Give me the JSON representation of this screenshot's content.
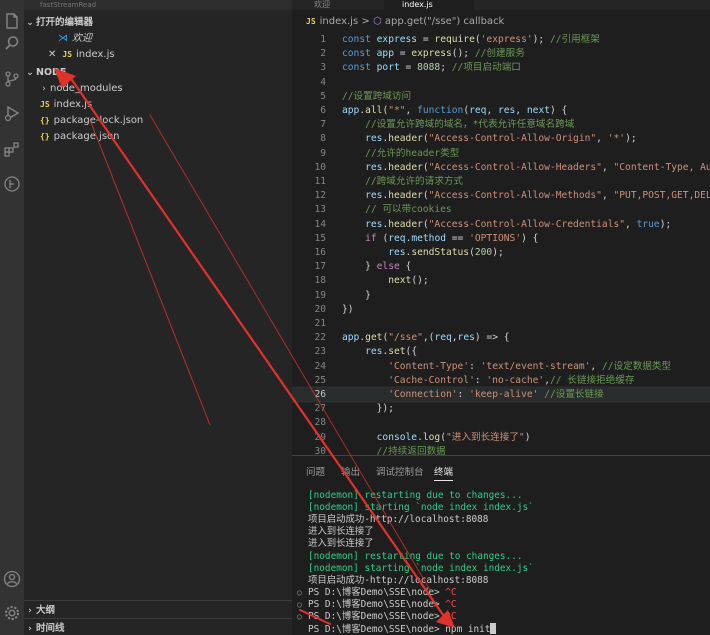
{
  "activity_icons": [
    "explorer-icon",
    "search-icon",
    "source-control-icon",
    "run-debug-icon",
    "extensions-icon",
    "remote-icon",
    "account-icon",
    "settings-icon"
  ],
  "sidebar": {
    "top_strip": "fastStreamRead",
    "open_editors_title": "打开的编辑器",
    "open_editors": [
      {
        "label": "欢迎",
        "icon": "vscode-icon",
        "italic": true
      },
      {
        "label": "index.js",
        "icon": "js-icon",
        "close": "✕"
      }
    ],
    "folder_title": "NODE",
    "files": [
      {
        "label": "node_modules",
        "type": "folder"
      },
      {
        "label": "index.js",
        "type": "js"
      },
      {
        "label": "package-lock.json",
        "type": "json"
      },
      {
        "label": "package.json",
        "type": "json"
      }
    ],
    "outline_title": "大纲",
    "timeline_title": "时间线"
  },
  "tabs": [
    {
      "label": "欢迎"
    },
    {
      "label": "index.js"
    }
  ],
  "breadcrumb": {
    "file": "index.js",
    "separator": ">",
    "symbol": "app.get(\"/sse\") callback"
  },
  "editor": {
    "current_line": 26,
    "lines": [
      {
        "n": 1,
        "t": [
          [
            "kw",
            "const "
          ],
          [
            "var",
            "express"
          ],
          [
            "p",
            " = "
          ],
          [
            "fn",
            "require"
          ],
          [
            "p",
            "("
          ],
          [
            "str",
            "'express'"
          ],
          [
            "p",
            "); "
          ],
          [
            "com",
            "//引用框架"
          ]
        ]
      },
      {
        "n": 2,
        "t": [
          [
            "kw",
            "const "
          ],
          [
            "var",
            "app"
          ],
          [
            "p",
            " = "
          ],
          [
            "fn",
            "express"
          ],
          [
            "p",
            "(); "
          ],
          [
            "com",
            "//创建服务"
          ]
        ]
      },
      {
        "n": 3,
        "t": [
          [
            "kw",
            "const "
          ],
          [
            "var",
            "port"
          ],
          [
            "p",
            " = "
          ],
          [
            "num",
            "8088"
          ],
          [
            "p",
            "; "
          ],
          [
            "com",
            "//项目启动端口"
          ]
        ]
      },
      {
        "n": 4,
        "t": []
      },
      {
        "n": 5,
        "t": [
          [
            "com",
            "//设置跨域访问"
          ]
        ]
      },
      {
        "n": 6,
        "t": [
          [
            "var",
            "app"
          ],
          [
            "p",
            "."
          ],
          [
            "fn",
            "all"
          ],
          [
            "p",
            "("
          ],
          [
            "str",
            "\"*\""
          ],
          [
            "p",
            ", "
          ],
          [
            "kw",
            "function"
          ],
          [
            "p",
            "("
          ],
          [
            "var",
            "req"
          ],
          [
            "p",
            ", "
          ],
          [
            "var",
            "res"
          ],
          [
            "p",
            ", "
          ],
          [
            "var",
            "next"
          ],
          [
            "p",
            ") {"
          ]
        ]
      },
      {
        "n": 7,
        "t": [
          [
            "p",
            "    "
          ],
          [
            "com",
            "//设置允许跨域的域名，*代表允许任意域名跨域"
          ]
        ]
      },
      {
        "n": 8,
        "t": [
          [
            "p",
            "    "
          ],
          [
            "var",
            "res"
          ],
          [
            "p",
            "."
          ],
          [
            "fn",
            "header"
          ],
          [
            "p",
            "("
          ],
          [
            "str",
            "\"Access-Control-Allow-Origin\""
          ],
          [
            "p",
            ", "
          ],
          [
            "str",
            "'*'"
          ],
          [
            "p",
            ");"
          ]
        ]
      },
      {
        "n": 9,
        "t": [
          [
            "p",
            "    "
          ],
          [
            "com",
            "//允许的header类型"
          ]
        ]
      },
      {
        "n": 10,
        "t": [
          [
            "p",
            "    "
          ],
          [
            "var",
            "res"
          ],
          [
            "p",
            "."
          ],
          [
            "fn",
            "header"
          ],
          [
            "p",
            "("
          ],
          [
            "str",
            "\"Access-Control-Allow-Headers\""
          ],
          [
            "p",
            ", "
          ],
          [
            "str",
            "\"Content-Type, Au"
          ]
        ]
      },
      {
        "n": 11,
        "t": [
          [
            "p",
            "    "
          ],
          [
            "com",
            "//跨域允许的请求方式"
          ]
        ]
      },
      {
        "n": 12,
        "t": [
          [
            "p",
            "    "
          ],
          [
            "var",
            "res"
          ],
          [
            "p",
            "."
          ],
          [
            "fn",
            "header"
          ],
          [
            "p",
            "("
          ],
          [
            "str",
            "\"Access-Control-Allow-Methods\""
          ],
          [
            "p",
            ", "
          ],
          [
            "str",
            "\"PUT,POST,GET,DEL"
          ]
        ]
      },
      {
        "n": 13,
        "t": [
          [
            "p",
            "    "
          ],
          [
            "com",
            "// 可以带cookies"
          ]
        ]
      },
      {
        "n": 14,
        "t": [
          [
            "p",
            "    "
          ],
          [
            "var",
            "res"
          ],
          [
            "p",
            "."
          ],
          [
            "fn",
            "header"
          ],
          [
            "p",
            "("
          ],
          [
            "str",
            "\"Access-Control-Allow-Credentials\""
          ],
          [
            "p",
            ", "
          ],
          [
            "kw",
            "true"
          ],
          [
            "p",
            ");"
          ]
        ]
      },
      {
        "n": 15,
        "t": [
          [
            "p",
            "    "
          ],
          [
            "ctl",
            "if"
          ],
          [
            "p",
            " ("
          ],
          [
            "var",
            "req"
          ],
          [
            "p",
            "."
          ],
          [
            "var",
            "method"
          ],
          [
            "p",
            " == "
          ],
          [
            "str",
            "'OPTIONS'"
          ],
          [
            "p",
            ") {"
          ]
        ]
      },
      {
        "n": 16,
        "t": [
          [
            "p",
            "        "
          ],
          [
            "var",
            "res"
          ],
          [
            "p",
            "."
          ],
          [
            "fn",
            "sendStatus"
          ],
          [
            "p",
            "("
          ],
          [
            "num",
            "200"
          ],
          [
            "p",
            ");"
          ]
        ]
      },
      {
        "n": 17,
        "t": [
          [
            "p",
            "    } "
          ],
          [
            "ctl",
            "else"
          ],
          [
            "p",
            " {"
          ]
        ]
      },
      {
        "n": 18,
        "t": [
          [
            "p",
            "        "
          ],
          [
            "fn",
            "next"
          ],
          [
            "p",
            "();"
          ]
        ]
      },
      {
        "n": 19,
        "t": [
          [
            "p",
            "    }"
          ]
        ]
      },
      {
        "n": 20,
        "t": [
          [
            "p",
            "})"
          ]
        ]
      },
      {
        "n": 21,
        "t": []
      },
      {
        "n": 22,
        "t": [
          [
            "var",
            "app"
          ],
          [
            "p",
            "."
          ],
          [
            "fn",
            "get"
          ],
          [
            "p",
            "("
          ],
          [
            "str",
            "\"/sse\""
          ],
          [
            "p",
            ",("
          ],
          [
            "var",
            "req"
          ],
          [
            "p",
            ","
          ],
          [
            "var",
            "res"
          ],
          [
            "p",
            ") => {"
          ]
        ]
      },
      {
        "n": 23,
        "t": [
          [
            "p",
            "    "
          ],
          [
            "var",
            "res"
          ],
          [
            "p",
            "."
          ],
          [
            "fn",
            "set"
          ],
          [
            "p",
            "({"
          ]
        ]
      },
      {
        "n": 24,
        "t": [
          [
            "p",
            "        "
          ],
          [
            "str",
            "'Content-Type'"
          ],
          [
            "p",
            ": "
          ],
          [
            "str",
            "'text/event-stream'"
          ],
          [
            "p",
            ", "
          ],
          [
            "com",
            "//设定数据类型"
          ]
        ]
      },
      {
        "n": 25,
        "t": [
          [
            "p",
            "        "
          ],
          [
            "str",
            "'Cache-Control'"
          ],
          [
            "p",
            ": "
          ],
          [
            "str",
            "'no-cache'"
          ],
          [
            "p",
            ","
          ],
          [
            "com",
            "// 长链接拒绝缓存"
          ]
        ]
      },
      {
        "n": 26,
        "t": [
          [
            "p",
            "        "
          ],
          [
            "str",
            "'Connection'"
          ],
          [
            "p",
            ": "
          ],
          [
            "str",
            "'keep-alive'"
          ],
          [
            "p",
            " "
          ],
          [
            "com",
            "//设置长链接"
          ]
        ]
      },
      {
        "n": 27,
        "t": [
          [
            "p",
            "      });"
          ]
        ]
      },
      {
        "n": 28,
        "t": []
      },
      {
        "n": 29,
        "t": [
          [
            "p",
            "      "
          ],
          [
            "var",
            "console"
          ],
          [
            "p",
            "."
          ],
          [
            "fn",
            "log"
          ],
          [
            "p",
            "("
          ],
          [
            "str",
            "\"进入到长连接了\""
          ],
          [
            "p",
            ")"
          ]
        ]
      },
      {
        "n": 30,
        "t": [
          [
            "p",
            "      "
          ],
          [
            "com",
            "//持续返回数据"
          ]
        ]
      }
    ]
  },
  "panel": {
    "tabs": [
      "问题",
      "输出",
      "调试控制台",
      "终端"
    ],
    "active_tab": "终端",
    "terminal": [
      {
        "text": "[nodemon] restarting due to changes...",
        "green": true
      },
      {
        "text": "[nodemon] starting `node index index.js`",
        "green": true
      },
      {
        "text": "项目启动成功-http://localhost:8088"
      },
      {
        "text": "进入到长连接了"
      },
      {
        "text": "进入到长连接了"
      },
      {
        "text": "[nodemon] restarting due to changes...",
        "green": true
      },
      {
        "text": "[nodemon] starting `node index index.js`",
        "green": true
      },
      {
        "text": "项目启动成功-http://localhost:8088"
      },
      {
        "prompt": "PS D:\\博客Demo\\SSE\\node> ",
        "ctrl": "^C",
        "dot": "○"
      },
      {
        "prompt": "PS D:\\博客Demo\\SSE\\node> ",
        "ctrl": "^C",
        "dot": "○"
      },
      {
        "prompt": "PS D:\\博客Demo\\SSE\\node> ",
        "ctrl": "^C",
        "dot": "○"
      },
      {
        "prompt": "PS D:\\博客Demo\\SSE\\node> ",
        "cmd": "npm init",
        "cursor": true
      }
    ]
  },
  "colors": {
    "annotation_arrow": "#e0322b",
    "activity_bar": "#333333",
    "sidebar": "#252526",
    "editor_bg": "#1e1e1e"
  }
}
